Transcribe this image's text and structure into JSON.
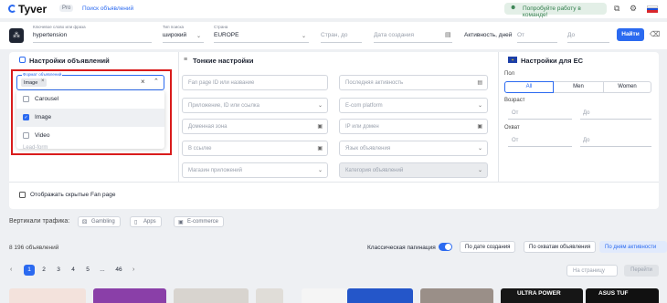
{
  "header": {
    "logo": "Tyver",
    "plan_badge": "Pro",
    "nav_link": "Поиск объявлений",
    "team_button": "Попробуйте работу в команде!"
  },
  "search": {
    "keyword_label": "Ключевое слово или фраза",
    "keyword_value": "hypertension",
    "match_label": "Тип поиска",
    "match_value": "широкий",
    "country_label": "Страна",
    "country_value": "EUROPE",
    "countries_placeholder": "Стран, до",
    "created_placeholder": "Дата создания",
    "activity_label": "Активность, дней",
    "from_placeholder": "От",
    "to_placeholder": "До",
    "submit_label": "Найти"
  },
  "ad_settings": {
    "title": "Настройки объявлений",
    "format_label": "Формат объявлений",
    "format_chip": "Image",
    "options": [
      {
        "label": "Carousel",
        "checked": false
      },
      {
        "label": "Image",
        "checked": true
      },
      {
        "label": "Video",
        "checked": false
      }
    ],
    "lead_form_placeholder": "Lead-form",
    "show_hidden_label": "Отображать скрытые Fan page"
  },
  "fine_settings": {
    "title": "Тонкие настройки",
    "fan_page_placeholder": "Fan page ID или название",
    "app_placeholder": "Приложение, ID или ссылка",
    "domain_placeholder": "Доменная зона",
    "link_placeholder": "В ссылке",
    "store_placeholder": "Магазин приложений",
    "last_activity_placeholder": "Последняя активность",
    "ecom_placeholder": "E-com platform",
    "ip_placeholder": "IP или домен",
    "lang_placeholder": "Язык объявления",
    "category_placeholder": "Категория объявлений"
  },
  "eu_settings": {
    "title": "Настройки для ЕС",
    "gender_label": "Пол",
    "gender_options": [
      "All",
      "Men",
      "Women"
    ],
    "age_label": "Возраст",
    "age_from": "От",
    "age_to": "До",
    "reach_label": "Охват",
    "reach_from": "От",
    "reach_to": "До"
  },
  "verticals": {
    "label": "Вертикали трафика:",
    "items": [
      "Gambling",
      "Apps",
      "E-commerce"
    ]
  },
  "results": {
    "count_text": "8 196 объявлений",
    "pagination_label": "Классическая пагинация",
    "sort_options": [
      "По дате создания",
      "По охватам объявления",
      "По дням активности"
    ],
    "pages": [
      "1",
      "2",
      "3",
      "4",
      "5",
      "...",
      "46"
    ],
    "goto_placeholder": "На страницу",
    "goto_button": "Перейти"
  },
  "colors": {
    "accent": "#2b6af0",
    "highlight_border": "#d91c1c",
    "team_green": "#2f7d4a"
  },
  "thumbnail_texts": [
    "ULTRA POWER",
    "ASUS TUF"
  ]
}
